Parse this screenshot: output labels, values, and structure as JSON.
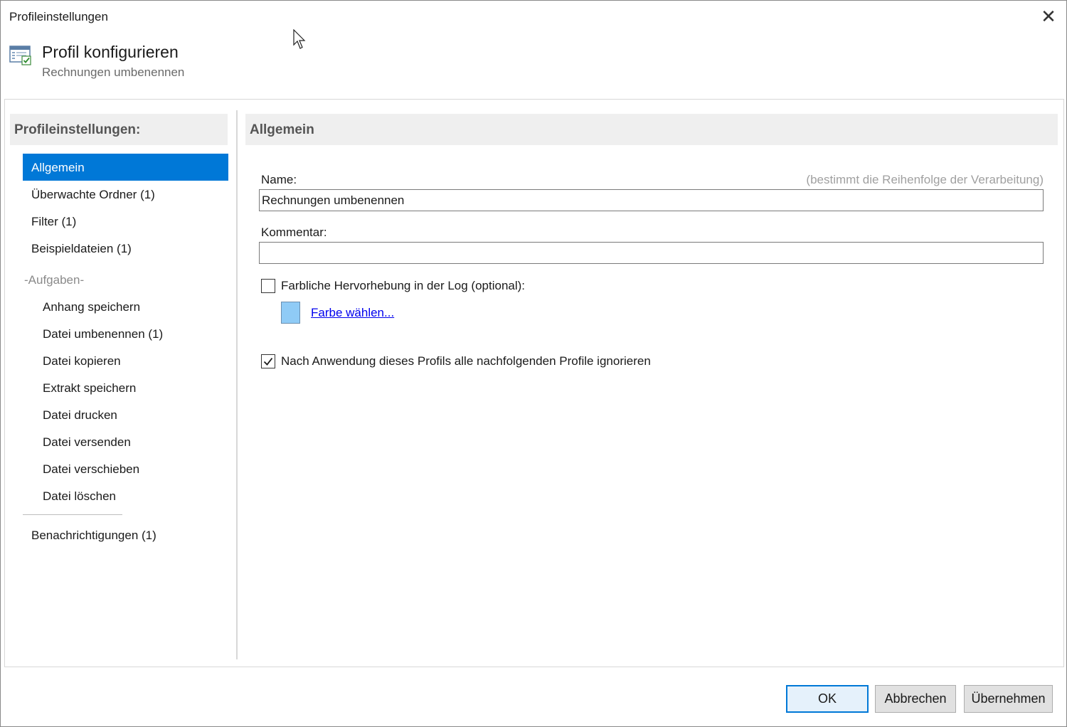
{
  "window": {
    "title": "Profileinstellungen"
  },
  "header": {
    "title": "Profil konfigurieren",
    "subtitle": "Rechnungen umbenennen",
    "icon": "settings-window-icon"
  },
  "sidebar": {
    "header": "Profileinstellungen:",
    "items": [
      {
        "label": "Allgemein",
        "selected": true
      },
      {
        "label": "Überwachte Ordner (1)"
      },
      {
        "label": "Filter (1)"
      },
      {
        "label": "Beispieldateien (1)"
      }
    ],
    "group_label": "-Aufgaben-",
    "tasks": [
      {
        "label": "Anhang speichern"
      },
      {
        "label": "Datei umbenennen (1)"
      },
      {
        "label": "Datei kopieren"
      },
      {
        "label": "Extrakt speichern"
      },
      {
        "label": "Datei drucken"
      },
      {
        "label": "Datei versenden"
      },
      {
        "label": "Datei verschieben"
      },
      {
        "label": "Datei löschen"
      }
    ],
    "notifications": "Benachrichtigungen (1)"
  },
  "panel": {
    "header": "Allgemein",
    "name_label": "Name:",
    "name_hint": "(bestimmt die Reihenfolge der Verarbeitung)",
    "name_value": "Rechnungen umbenennen",
    "comment_label": "Kommentar:",
    "comment_value": "",
    "highlight_checkbox_label": "Farbliche Hervorhebung in der Log (optional):",
    "highlight_checked": false,
    "swatch_color": "#8fcbf6",
    "choose_color_link": "Farbe wählen...",
    "ignore_checkbox_label": "Nach Anwendung dieses Profils alle nachfolgenden Profile ignorieren",
    "ignore_checked": true
  },
  "buttons": {
    "ok": "OK",
    "cancel": "Abbrechen",
    "apply": "Übernehmen"
  },
  "colors": {
    "accent": "#0078d7"
  }
}
